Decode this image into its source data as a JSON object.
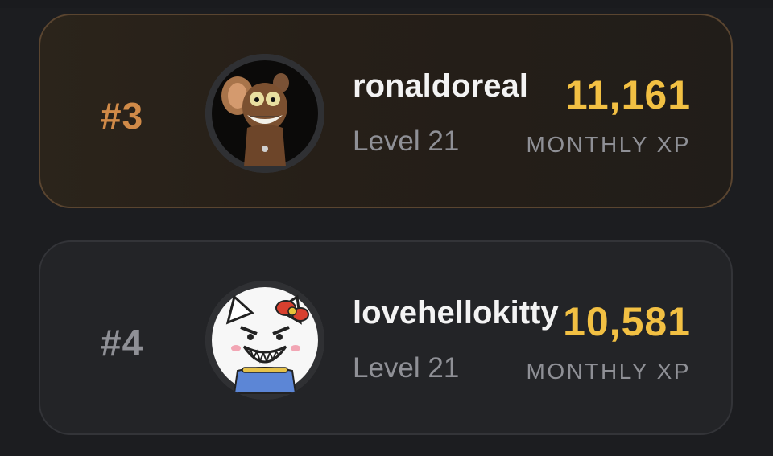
{
  "leaderboard": {
    "entries": [
      {
        "rank": "#3",
        "username": "ronaldoreal",
        "level": "Level 21",
        "xp": "11,161",
        "xp_label": "MONTHLY XP",
        "avatar_icon": "cartoon-mouse-avatar-icon",
        "rank_color": "#d08a48"
      },
      {
        "rank": "#4",
        "username": "lovehellokitty",
        "level": "Level 21",
        "xp": "10,581",
        "xp_label": "MONTHLY XP",
        "avatar_icon": "angry-kitty-avatar-icon",
        "rank_color": "#8f9096"
      }
    ],
    "xp_color": "#f2c043"
  }
}
